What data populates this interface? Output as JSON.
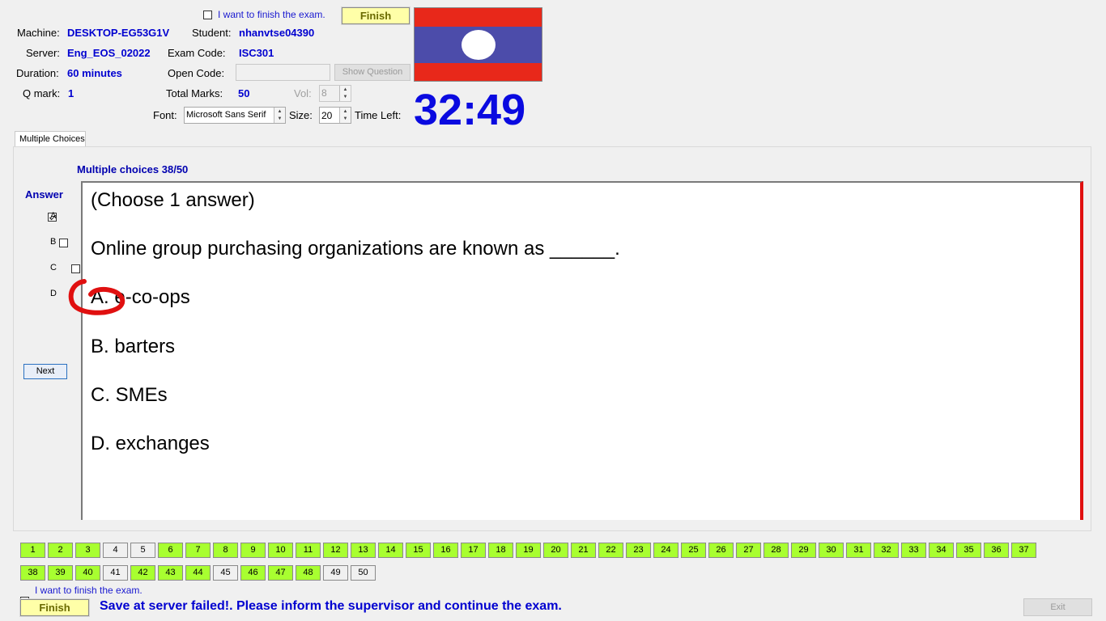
{
  "header": {
    "finish_top_check_label": "I want to finish the exam.",
    "finish_top_label": "Finish",
    "machine_label": "Machine:",
    "machine_value": "DESKTOP-EG53G1V",
    "student_label": "Student:",
    "student_value": "nhanvtse04390",
    "server_label": "Server:",
    "server_value": "Eng_EOS_02022",
    "exam_code_label": "Exam Code:",
    "exam_code_value": "ISC301",
    "duration_label": "Duration:",
    "duration_value": "60 minutes",
    "open_code_label": "Open Code:",
    "open_code_value": "",
    "show_question_label": "Show Question",
    "qmark_label": "Q mark:",
    "qmark_value": "1",
    "total_marks_label": "Total Marks:",
    "total_marks_value": "50",
    "vol_label": "Vol:",
    "vol_value": "8",
    "font_label": "Font:",
    "font_value": "Microsoft Sans Serif",
    "size_label": "Size:",
    "size_value": "20",
    "time_left_label": "Time Left:",
    "timer_value": "32:49",
    "flag_colors": {
      "band": "#e8281a",
      "center": "#4c4caa",
      "circle": "#ffffff"
    }
  },
  "tabs": [
    {
      "label": "Multiple Choices"
    }
  ],
  "main": {
    "section_title": "Multiple choices 38/50",
    "answer_title": "Answer",
    "answers": [
      {
        "label": "A",
        "checked": true
      },
      {
        "label": "B",
        "checked": false
      },
      {
        "label": "C",
        "checked": false
      },
      {
        "label": "D",
        "checked": false
      }
    ],
    "next_label": "Next",
    "question": {
      "instruction": "(Choose 1 answer)",
      "text": "Online group purchasing organizations are known as ______.",
      "options": [
        {
          "letter": "A.",
          "text": "e-co-ops"
        },
        {
          "letter": "B.",
          "text": "barters"
        },
        {
          "letter": "C.",
          "text": "SMEs"
        },
        {
          "letter": "D.",
          "text": "exchanges"
        }
      ]
    }
  },
  "question_nav": {
    "answered_color": "#a8ff30",
    "items": [
      {
        "n": "1",
        "answered": true
      },
      {
        "n": "2",
        "answered": true
      },
      {
        "n": "3",
        "answered": true
      },
      {
        "n": "4",
        "answered": false
      },
      {
        "n": "5",
        "answered": false
      },
      {
        "n": "6",
        "answered": true
      },
      {
        "n": "7",
        "answered": true
      },
      {
        "n": "8",
        "answered": true
      },
      {
        "n": "9",
        "answered": true
      },
      {
        "n": "10",
        "answered": true
      },
      {
        "n": "11",
        "answered": true
      },
      {
        "n": "12",
        "answered": true
      },
      {
        "n": "13",
        "answered": true
      },
      {
        "n": "14",
        "answered": true
      },
      {
        "n": "15",
        "answered": true
      },
      {
        "n": "16",
        "answered": true
      },
      {
        "n": "17",
        "answered": true
      },
      {
        "n": "18",
        "answered": true
      },
      {
        "n": "19",
        "answered": true
      },
      {
        "n": "20",
        "answered": true
      },
      {
        "n": "21",
        "answered": true
      },
      {
        "n": "22",
        "answered": true
      },
      {
        "n": "23",
        "answered": true
      },
      {
        "n": "24",
        "answered": true
      },
      {
        "n": "25",
        "answered": true
      },
      {
        "n": "26",
        "answered": true
      },
      {
        "n": "27",
        "answered": true
      },
      {
        "n": "28",
        "answered": true
      },
      {
        "n": "29",
        "answered": true
      },
      {
        "n": "30",
        "answered": true
      },
      {
        "n": "31",
        "answered": true
      },
      {
        "n": "32",
        "answered": true
      },
      {
        "n": "33",
        "answered": true
      },
      {
        "n": "34",
        "answered": true
      },
      {
        "n": "35",
        "answered": true
      },
      {
        "n": "36",
        "answered": true
      },
      {
        "n": "37",
        "answered": true
      },
      {
        "n": "38",
        "answered": true
      },
      {
        "n": "39",
        "answered": true
      },
      {
        "n": "40",
        "answered": true
      },
      {
        "n": "41",
        "answered": false
      },
      {
        "n": "42",
        "answered": true
      },
      {
        "n": "43",
        "answered": true
      },
      {
        "n": "44",
        "answered": true
      },
      {
        "n": "45",
        "answered": false
      },
      {
        "n": "46",
        "answered": true
      },
      {
        "n": "47",
        "answered": true
      },
      {
        "n": "48",
        "answered": true
      },
      {
        "n": "49",
        "answered": false
      },
      {
        "n": "50",
        "answered": false
      }
    ]
  },
  "footer": {
    "finish_check_label": "I want to finish the exam.",
    "finish_label": "Finish",
    "status_message": "Save at server failed!. Please inform the supervisor and continue the exam.",
    "exit_label": "Exit"
  }
}
